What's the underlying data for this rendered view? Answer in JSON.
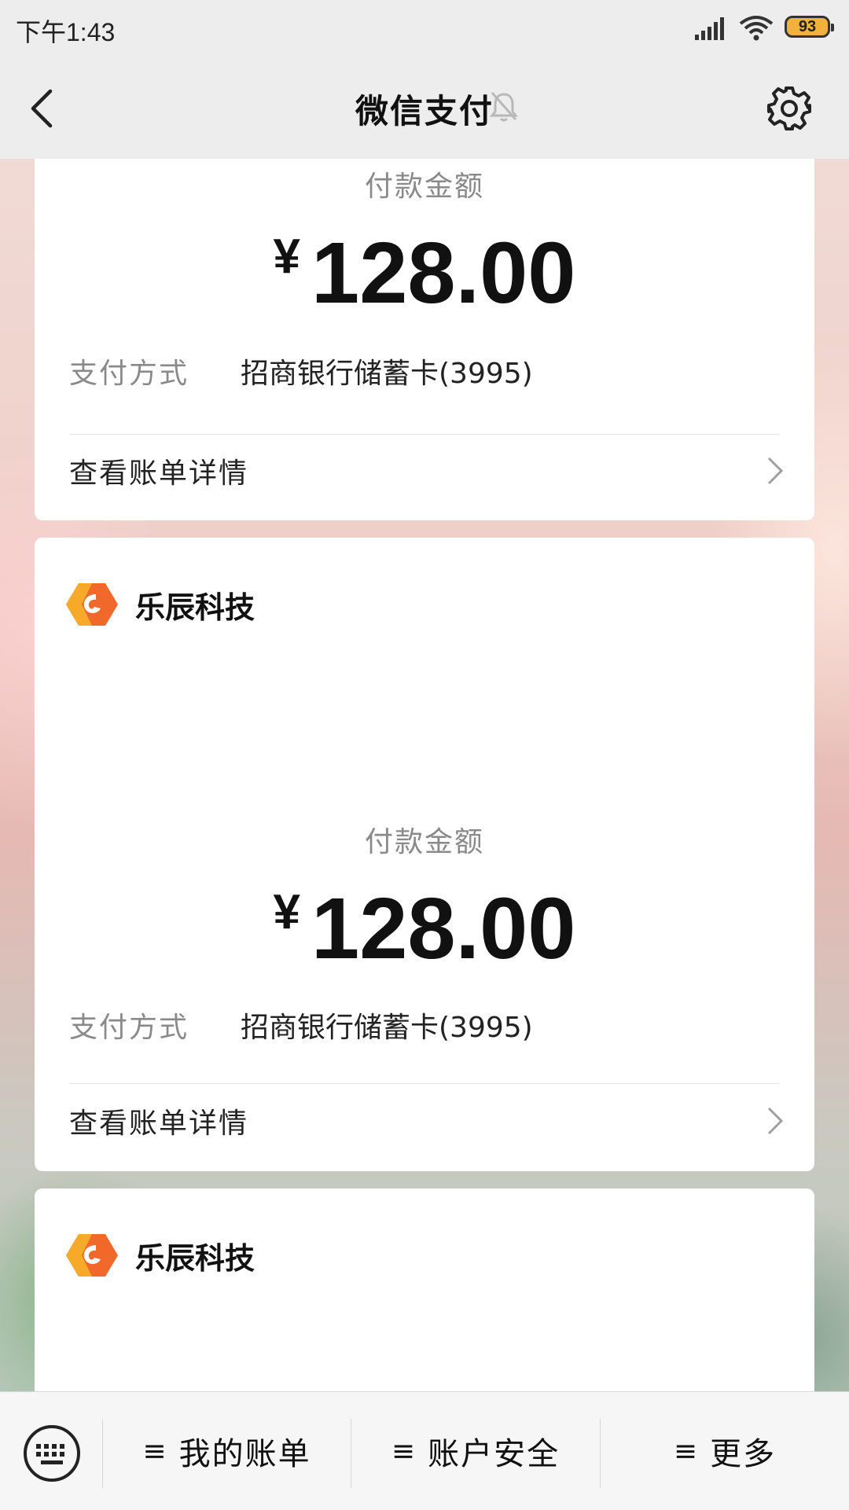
{
  "status_bar": {
    "time": "下午1:43",
    "battery": "93"
  },
  "nav": {
    "title": "微信支付"
  },
  "cards": [
    {
      "amount_label": "付款金额",
      "currency": "¥",
      "amount": "128.00",
      "pay_method_label": "支付方式",
      "pay_method_value": "招商银行储蓄卡(3995)",
      "bill_link": "查看账单详情"
    },
    {
      "merchant": "乐辰科技",
      "amount_label": "付款金额",
      "currency": "¥",
      "amount": "128.00",
      "pay_method_label": "支付方式",
      "pay_method_value": "招商银行储蓄卡(3995)",
      "bill_link": "查看账单详情"
    },
    {
      "merchant": "乐辰科技"
    }
  ],
  "bottom_menu": {
    "items": [
      "我的账单",
      "账户安全",
      "更多"
    ],
    "hamburger": "≡"
  },
  "icons": {
    "signal": "signal-icon",
    "wifi": "wifi-icon",
    "mute": "mute-bell-icon",
    "settings": "gear-icon",
    "back": "back-arrow-icon",
    "keyboard": "keyboard-icon"
  },
  "colors": {
    "nav_background": "#ededed",
    "battery": "#f1b23b",
    "logo_orange": "#f0692a",
    "logo_yellow": "#f7a92a"
  }
}
